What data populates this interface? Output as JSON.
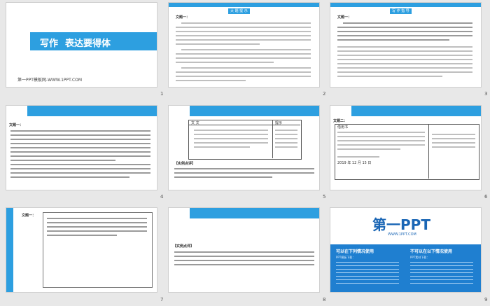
{
  "slide_numbers": [
    "1",
    "2",
    "3",
    "4",
    "5",
    "6",
    "7",
    "8",
    "9"
  ],
  "s1": {
    "title_a": "写作",
    "title_b": "表达要得体",
    "footer": "第一PPT模板网-WWW.1PPT.COM"
  },
  "s2": {
    "box_label": "大 题 提 示",
    "heading": "文题一："
  },
  "s3": {
    "box_label": "写 作 指 导",
    "heading": "文题一："
  },
  "s4": {
    "heading": "文题一："
  },
  "s5": {
    "col_left": "文   文",
    "col_right": "提示",
    "review": "【实例点评】"
  },
  "s6": {
    "heading": "文题二：",
    "sub": "借用书",
    "date": "2019 年 12 月 15 日"
  },
  "s7": {
    "heading": "文题一："
  },
  "s8": {
    "review": "【实例点评】"
  },
  "s9": {
    "logo": "第一PPT",
    "logo_sub": "WWW.1PPT.COM",
    "left_title": "可以在下列情况使用",
    "right_title": "不可以在以下情况使用",
    "left_head": "PPT模板下载：",
    "right_head": "PPT素材下载："
  }
}
